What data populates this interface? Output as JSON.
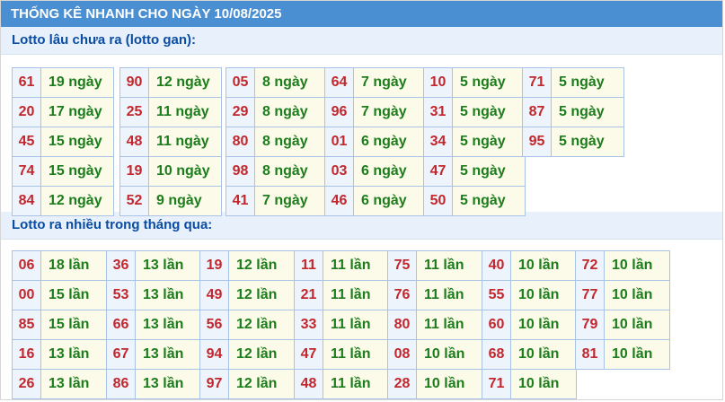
{
  "header": {
    "title": "THỐNG KÊ NHANH CHO NGÀY 10/08/2025"
  },
  "gan": {
    "heading": "Lotto lâu chưa ra (lotto gan):",
    "groups": [
      {
        "rows": [
          {
            "n": "61",
            "c": "19 ngày"
          },
          {
            "n": "20",
            "c": "17 ngày"
          },
          {
            "n": "45",
            "c": "15 ngày"
          },
          {
            "n": "74",
            "c": "15 ngày"
          },
          {
            "n": "84",
            "c": "12 ngày"
          }
        ]
      },
      {
        "rows": [
          {
            "n": "90",
            "c": "12 ngày"
          },
          {
            "n": "25",
            "c": "11 ngày"
          },
          {
            "n": "48",
            "c": "11 ngày"
          },
          {
            "n": "19",
            "c": "10 ngày"
          },
          {
            "n": "52",
            "c": "9 ngày"
          }
        ]
      },
      {
        "rows": [
          {
            "n": "05",
            "c": "8 ngày"
          },
          {
            "n": "29",
            "c": "8 ngày"
          },
          {
            "n": "80",
            "c": "8 ngày"
          },
          {
            "n": "98",
            "c": "8 ngày"
          },
          {
            "n": "41",
            "c": "7 ngày"
          }
        ]
      },
      {
        "rows": [
          {
            "n": "64",
            "c": "7 ngày"
          },
          {
            "n": "96",
            "c": "7 ngày"
          },
          {
            "n": "01",
            "c": "6 ngày"
          },
          {
            "n": "03",
            "c": "6 ngày"
          },
          {
            "n": "46",
            "c": "6 ngày"
          }
        ]
      },
      {
        "rows": [
          {
            "n": "10",
            "c": "5 ngày"
          },
          {
            "n": "31",
            "c": "5 ngày"
          },
          {
            "n": "34",
            "c": "5 ngày"
          },
          {
            "n": "47",
            "c": "5 ngày"
          },
          {
            "n": "50",
            "c": "5 ngày"
          }
        ]
      },
      {
        "rows": [
          {
            "n": "71",
            "c": "5 ngày"
          },
          {
            "n": "87",
            "c": "5 ngày"
          },
          {
            "n": "95",
            "c": "5 ngày"
          }
        ]
      }
    ]
  },
  "frequent": {
    "heading": "Lotto ra nhiều trong tháng qua:",
    "groups": [
      {
        "rows": [
          {
            "n": "06",
            "c": "18 lần"
          },
          {
            "n": "00",
            "c": "15 lần"
          },
          {
            "n": "85",
            "c": "15 lần"
          },
          {
            "n": "16",
            "c": "13 lần"
          },
          {
            "n": "26",
            "c": "13 lần"
          }
        ]
      },
      {
        "rows": [
          {
            "n": "36",
            "c": "13 lần"
          },
          {
            "n": "53",
            "c": "13 lần"
          },
          {
            "n": "66",
            "c": "13 lần"
          },
          {
            "n": "67",
            "c": "13 lần"
          },
          {
            "n": "86",
            "c": "13 lần"
          }
        ]
      },
      {
        "rows": [
          {
            "n": "19",
            "c": "12 lần"
          },
          {
            "n": "49",
            "c": "12 lần"
          },
          {
            "n": "56",
            "c": "12 lần"
          },
          {
            "n": "94",
            "c": "12 lần"
          },
          {
            "n": "97",
            "c": "12 lần"
          }
        ]
      },
      {
        "rows": [
          {
            "n": "11",
            "c": "11 lần"
          },
          {
            "n": "21",
            "c": "11 lần"
          },
          {
            "n": "33",
            "c": "11 lần"
          },
          {
            "n": "47",
            "c": "11 lần"
          },
          {
            "n": "48",
            "c": "11 lần"
          }
        ]
      },
      {
        "rows": [
          {
            "n": "75",
            "c": "11 lần"
          },
          {
            "n": "76",
            "c": "11 lần"
          },
          {
            "n": "80",
            "c": "11 lần"
          },
          {
            "n": "08",
            "c": "10 lần"
          },
          {
            "n": "28",
            "c": "10 lần"
          }
        ]
      },
      {
        "rows": [
          {
            "n": "40",
            "c": "10 lần"
          },
          {
            "n": "55",
            "c": "10 lần"
          },
          {
            "n": "60",
            "c": "10 lần"
          },
          {
            "n": "68",
            "c": "10 lần"
          },
          {
            "n": "71",
            "c": "10 lần"
          }
        ]
      },
      {
        "rows": [
          {
            "n": "72",
            "c": "10 lần"
          },
          {
            "n": "77",
            "c": "10 lần"
          },
          {
            "n": "79",
            "c": "10 lần"
          },
          {
            "n": "81",
            "c": "10 lần"
          }
        ]
      }
    ]
  }
}
